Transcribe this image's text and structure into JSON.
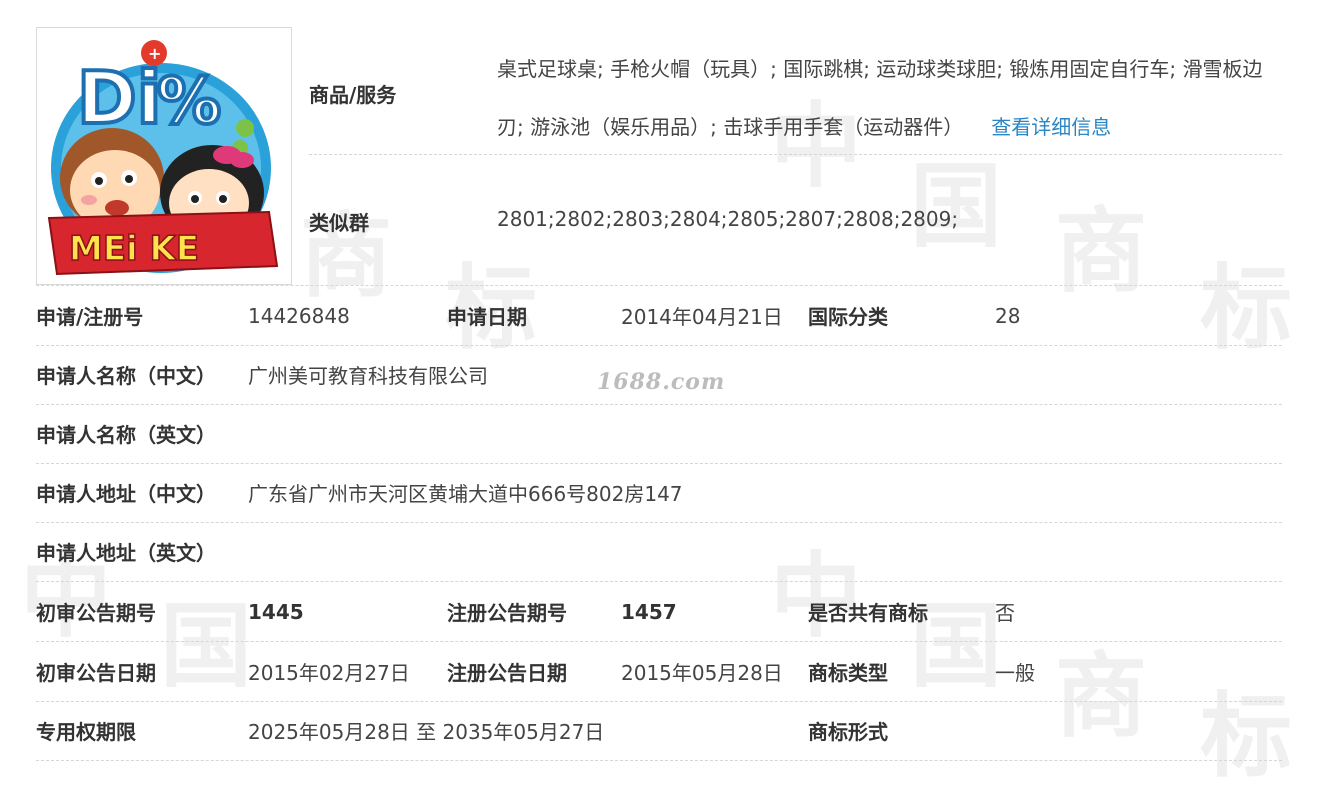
{
  "logo": {
    "text_top": "Di",
    "text_banner": "MEi KE"
  },
  "watermark": {
    "text": "1688.com",
    "glyphs": [
      "中",
      "国",
      "商",
      "标"
    ]
  },
  "goods": {
    "label": "商品/服务",
    "text": "桌式足球桌; 手枪火帽（玩具）; 国际跳棋; 运动球类球胆; 锻炼用固定自行车; 滑雪板边刃; 游泳池（娱乐用品）; 击球手用手套（运动器件）",
    "link": "查看详细信息"
  },
  "similar_group": {
    "label": "类似群",
    "value": "2801;2802;2803;2804;2805;2807;2808;2809;"
  },
  "rows": {
    "reg_no": {
      "label": "申请/注册号",
      "value": "14426848"
    },
    "apply_date": {
      "label": "申请日期",
      "value": "2014年04月21日"
    },
    "intl_class": {
      "label": "国际分类",
      "value": "28"
    },
    "applicant_cn": {
      "label": "申请人名称（中文）",
      "value": "广州美可教育科技有限公司"
    },
    "applicant_en": {
      "label": "申请人名称（英文）",
      "value": ""
    },
    "address_cn": {
      "label": "申请人地址（中文）",
      "value": "广东省广州市天河区黄埔大道中666号802房147"
    },
    "address_en": {
      "label": "申请人地址（英文）",
      "value": ""
    },
    "prelim_issue": {
      "label": "初审公告期号",
      "value": "1445"
    },
    "reg_issue": {
      "label": "注册公告期号",
      "value": "1457"
    },
    "shared": {
      "label": "是否共有商标",
      "value": "否"
    },
    "prelim_date": {
      "label": "初审公告日期",
      "value": "2015年02月27日"
    },
    "reg_date": {
      "label": "注册公告日期",
      "value": "2015年05月28日"
    },
    "tm_type": {
      "label": "商标类型",
      "value": "一般"
    },
    "validity": {
      "label": "专用权期限",
      "value": "2025年05月28日 至 2035年05月27日"
    },
    "tm_form": {
      "label": "商标形式",
      "value": ""
    }
  }
}
